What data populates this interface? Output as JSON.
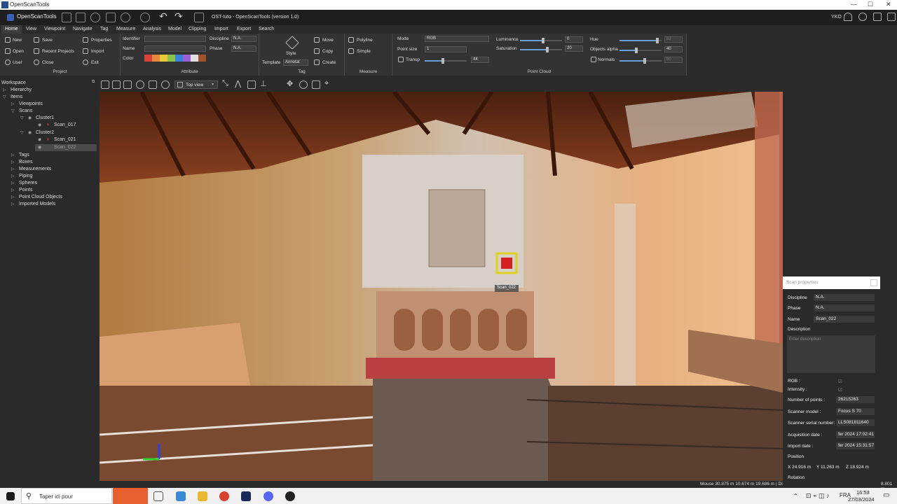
{
  "window": {
    "title": "OpenScanTools"
  },
  "app": {
    "brand": "OpenScanTools",
    "document": "OST-tuto - OpenScanTools (version 1.0)",
    "user": "YKO"
  },
  "menu": [
    "Home",
    "View",
    "Viewpoint",
    "Navigate",
    "Tag",
    "Measure",
    "Analysis",
    "Model",
    "Clipping",
    "Import",
    "Export",
    "Search"
  ],
  "ribbon": {
    "project": {
      "label": "Project",
      "new": "New",
      "save": "Save",
      "properties": "Properties",
      "open": "Open",
      "recent": "Recent Projects",
      "import": "Import",
      "user": "User",
      "close": "Close",
      "exit": "Exit"
    },
    "attribute": {
      "label": "Attribute",
      "identifier": "Identifier",
      "discipline": "Discipline",
      "discipline_val": "N.A.",
      "name": "Name",
      "phase": "Phase",
      "phase_val": "N.A.",
      "color": "Color",
      "swatches": [
        "#d9433a",
        "#e8893a",
        "#e8c93a",
        "#8bc34a",
        "#3a7fd9",
        "#9a5fd9",
        "#e0e0e0",
        "#a0522d"
      ]
    },
    "tag": {
      "label": "Tag",
      "style": "Style",
      "template": "Template",
      "template_val": "Annotat",
      "move": "Move",
      "copy": "Copy",
      "create": "Create"
    },
    "measure": {
      "label": "Measure",
      "polyline": "Polyline",
      "simple": "Simple"
    },
    "pointcloud": {
      "label": "Point Cloud",
      "mode": "Mode",
      "mode_val": "RGB",
      "point_size": "Point size",
      "point_size_val": "1",
      "transp": "Transp",
      "transp_val": "44",
      "luminance": "Luminance",
      "luminance_val": "0",
      "saturation": "Saturation",
      "saturation_val": "20",
      "hue": "Hue",
      "hue_val": "62",
      "objects_alpha": "Objects alpha",
      "objects_alpha_val": "40",
      "normals": "Normals",
      "normals_val": "60",
      "luminance_level": 0.55,
      "saturation_level": 0.65,
      "hue_level": 0.9,
      "alpha_level": 0.4,
      "transp_level": 0.44,
      "normals_level": 0.6
    }
  },
  "tree": {
    "workspace": "Workspace",
    "hierarchy": "Hierarchy",
    "items": "Items",
    "viewpoints": "Viewpoints",
    "scans": "Scans",
    "cluster1": "Cluster1",
    "scan017": "Scan_017",
    "cluster2": "Cluster2",
    "scan021": "Scan_021",
    "scan022": "Scan_022",
    "others": [
      "Tags",
      "Boxes",
      "Measurements",
      "Piping",
      "Spheres",
      "Points",
      "Point Cloud Objects",
      "Imported Models"
    ]
  },
  "viewtool": {
    "view_mode": "Top view"
  },
  "viewport": {
    "scan_label": "Scan_022"
  },
  "props": {
    "title": "Scan properties",
    "discipline": "Discipline",
    "discipline_val": "N.A.",
    "phase": "Phase",
    "phase_val": "N.A.",
    "name": "Name",
    "name_val": "Scan_022",
    "description": "Description",
    "description_ph": "Enter description",
    "rgb": "RGB :",
    "rgb_val": "☑",
    "intensity": "Intensity :",
    "intensity_val": "☑",
    "points": "Number of points :",
    "points_val": "26215263",
    "model": "Scanner model :",
    "model_val": "Focus S 70",
    "serial": "Scanner serial number:",
    "serial_val": "LLS081811640",
    "acq": "Acquisition date :",
    "acq_val": "fer 2024 17:02:41",
    "imp": "Import date :",
    "imp_val": "fer 2024 15:31:57",
    "position": "Position",
    "pos_x": "X  24.916 m",
    "pos_y": "Y  11.263 m",
    "pos_z": "Z  18.924 m",
    "rotation": "Rotation"
  },
  "status": {
    "mouse": "Mouse 30.875 m 10.674 m 19.686 m | Di",
    "right": "8.801 m"
  },
  "taskbar": {
    "search": "Taper ici pour",
    "time": "16:53",
    "date": "27/03/2024"
  },
  "colors": {
    "accent": "#3a5fb0",
    "highlight": "#d42020",
    "tag_border": "#e0d020"
  }
}
